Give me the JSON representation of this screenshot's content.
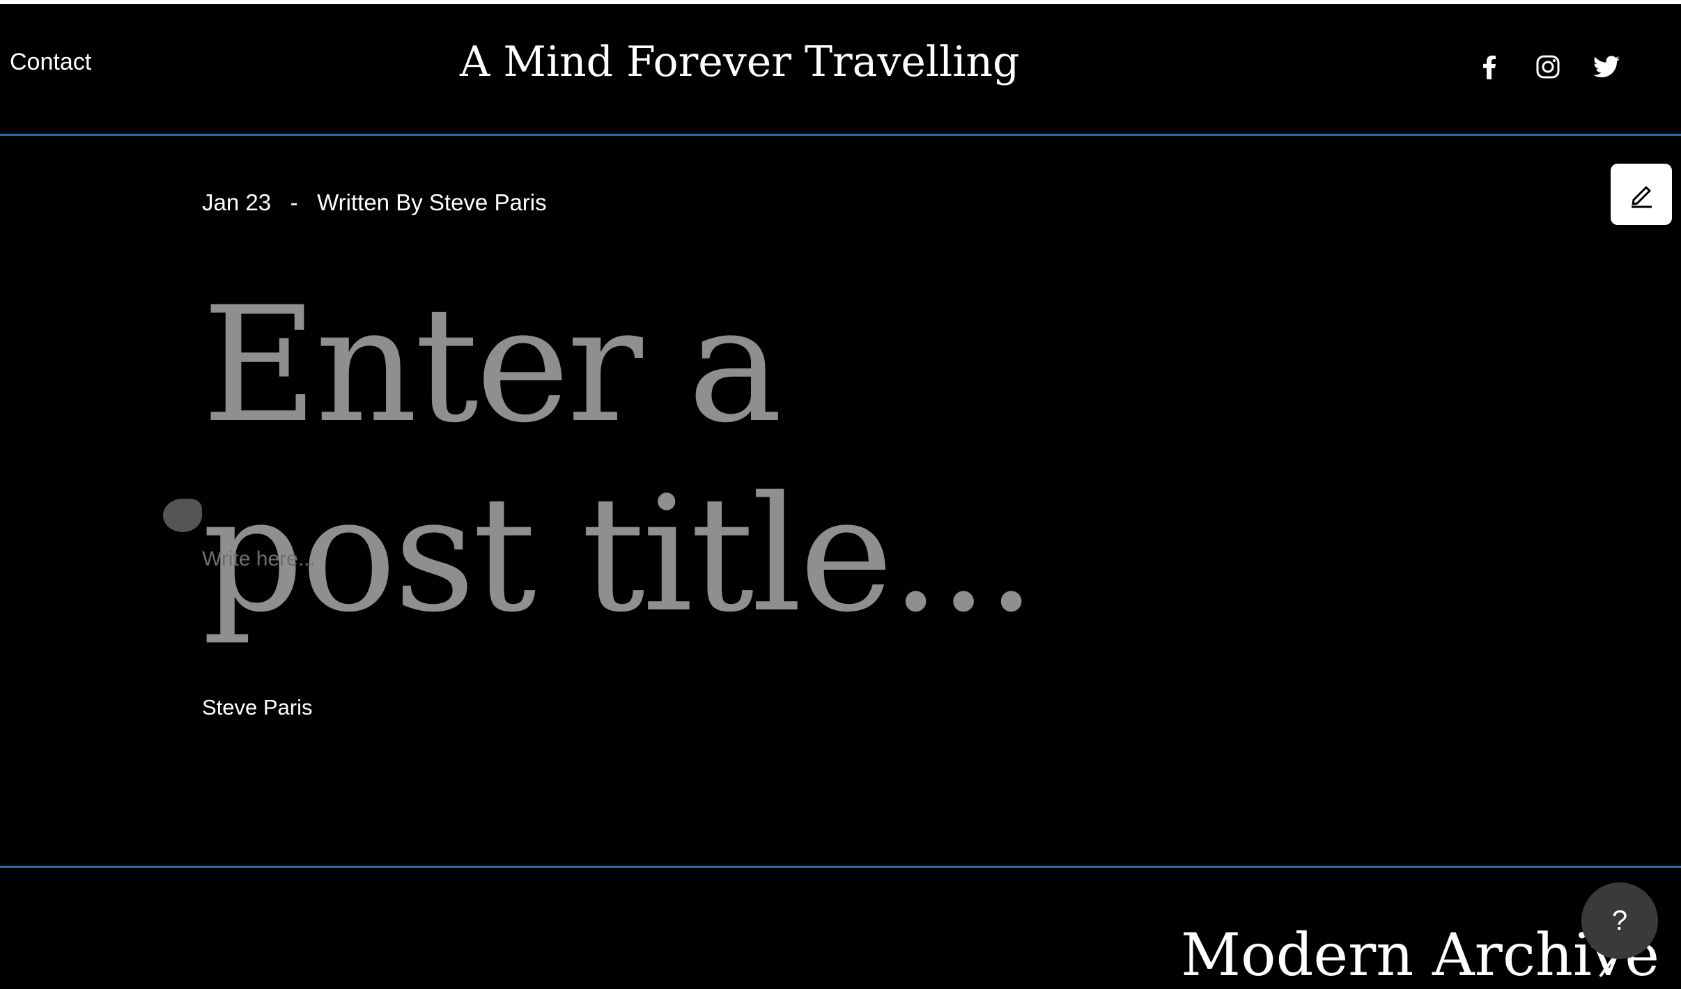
{
  "header": {
    "contact_label": "Contact",
    "site_title": "A Mind Forever Travelling",
    "social": [
      "facebook-icon",
      "instagram-icon",
      "twitter-icon"
    ]
  },
  "colors": {
    "background": "#000000",
    "accent_rule": "#2c6fa8",
    "title_placeholder": "#8f8f8f"
  },
  "post": {
    "date": "Jan 23",
    "separator": "-",
    "byline": "Written By Steve Paris",
    "title_placeholder": "Enter a post title...",
    "body_placeholder": "Write here...",
    "author": "Steve Paris"
  },
  "toolbar": {
    "edit_icon": "pencil-icon"
  },
  "footer": {
    "archive_label": "Modern Archive"
  },
  "help": {
    "label": "?"
  }
}
